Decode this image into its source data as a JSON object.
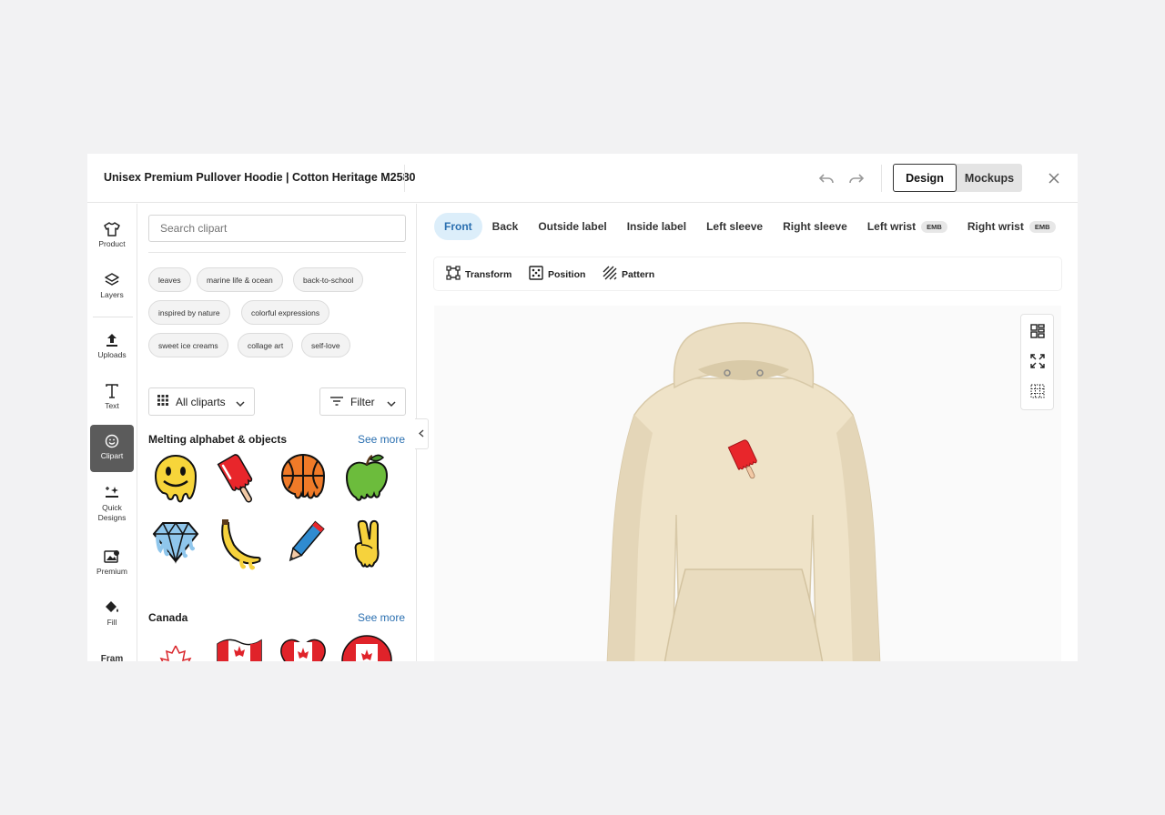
{
  "header": {
    "title": "Unisex Premium Pullover Hoodie | Cotton Heritage M2580",
    "mode_tabs": [
      "Design",
      "Mockups"
    ],
    "active_mode": "Design"
  },
  "rail": {
    "items": [
      {
        "label": "Product",
        "icon": "shirt-icon"
      },
      {
        "label": "Layers",
        "icon": "layers-icon"
      },
      {
        "label": "Uploads",
        "icon": "upload-icon"
      },
      {
        "label": "Text",
        "icon": "text-icon"
      },
      {
        "label": "Clipart",
        "icon": "smiley-icon",
        "active": true
      },
      {
        "label": "Quick Designs",
        "icon": "sparkle-icon"
      },
      {
        "label": "Premium",
        "icon": "premium-image-icon"
      },
      {
        "label": "Fill",
        "icon": "paint-bucket-icon"
      }
    ],
    "partial_label": "Fram"
  },
  "panel": {
    "search_placeholder": "Search clipart",
    "chips": [
      "leaves",
      "marine life & ocean",
      "back-to-school",
      "inspired by nature",
      "colorful expressions",
      "sweet ice creams",
      "collage art",
      "self-love"
    ],
    "all_cliparts_label": "All cliparts",
    "filter_label": "Filter",
    "sections": [
      {
        "title": "Melting alphabet & objects",
        "see_more": "See more",
        "items": [
          "melting-smiley",
          "melting-popsicle",
          "melting-basketball",
          "melting-apple",
          "melting-diamond",
          "melting-banana",
          "melting-pencil",
          "melting-peace-hand"
        ]
      },
      {
        "title": "Canada",
        "see_more": "See more",
        "items": [
          "maple-leaf-outline",
          "canada-flag-wave",
          "canada-heart",
          "canada-circle"
        ]
      }
    ]
  },
  "placement_tabs": [
    {
      "label": "Front",
      "active": true
    },
    {
      "label": "Back"
    },
    {
      "label": "Outside label"
    },
    {
      "label": "Inside label"
    },
    {
      "label": "Left sleeve"
    },
    {
      "label": "Right sleeve"
    },
    {
      "label": "Left wrist",
      "badge": "EMB"
    },
    {
      "label": "Right wrist",
      "badge": "EMB"
    }
  ],
  "toolbar": {
    "transform": "Transform",
    "position": "Position",
    "pattern": "Pattern"
  },
  "colors": {
    "accent": "#2a6fb0",
    "active_tab_bg": "#dceefa",
    "hoodie": "#efe3c8"
  }
}
